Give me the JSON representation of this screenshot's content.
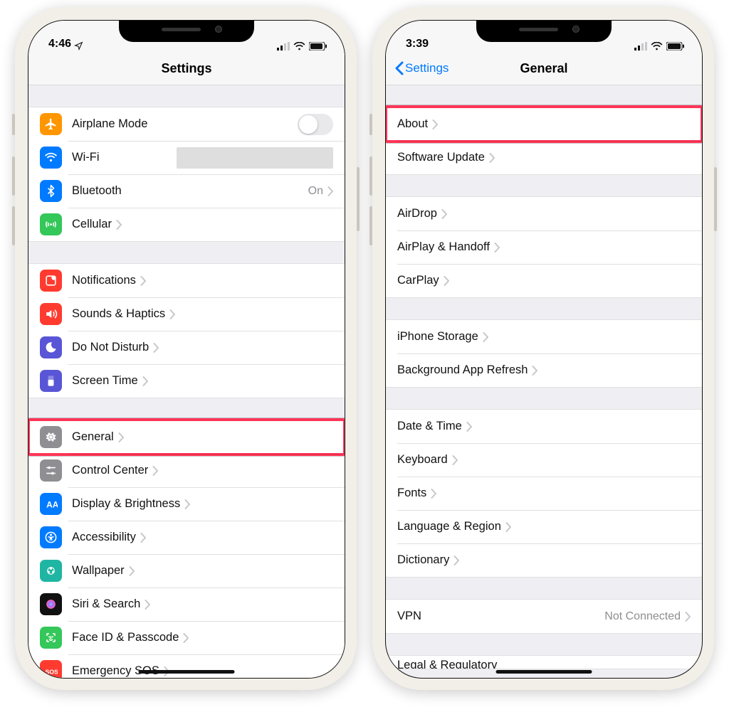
{
  "left": {
    "status": {
      "time": "4:46"
    },
    "nav": {
      "title": "Settings"
    },
    "groups": [
      {
        "rows": [
          {
            "id": "airplane",
            "label": "Airplane Mode",
            "icon": "airplane-icon",
            "type": "toggle"
          },
          {
            "id": "wifi",
            "label": "Wi-Fi",
            "icon": "wifi-icon",
            "type": "wifi"
          },
          {
            "id": "bluetooth",
            "label": "Bluetooth",
            "icon": "bluetooth-icon",
            "type": "nav",
            "value": "On"
          },
          {
            "id": "cellular",
            "label": "Cellular",
            "icon": "cellular-icon",
            "type": "nav"
          }
        ]
      },
      {
        "rows": [
          {
            "id": "notifications",
            "label": "Notifications",
            "icon": "notifications-icon",
            "type": "nav"
          },
          {
            "id": "sounds",
            "label": "Sounds & Haptics",
            "icon": "sounds-icon",
            "type": "nav"
          },
          {
            "id": "dnd",
            "label": "Do Not Disturb",
            "icon": "dnd-icon",
            "type": "nav"
          },
          {
            "id": "screentime",
            "label": "Screen Time",
            "icon": "screentime-icon",
            "type": "nav"
          }
        ]
      },
      {
        "rows": [
          {
            "id": "general",
            "label": "General",
            "icon": "general-icon",
            "type": "nav",
            "highlight": true
          },
          {
            "id": "controlcenter",
            "label": "Control Center",
            "icon": "controlcenter-icon",
            "type": "nav"
          },
          {
            "id": "display",
            "label": "Display & Brightness",
            "icon": "display-icon",
            "type": "nav"
          },
          {
            "id": "accessibility",
            "label": "Accessibility",
            "icon": "accessibility-icon",
            "type": "nav"
          },
          {
            "id": "wallpaper",
            "label": "Wallpaper",
            "icon": "wallpaper-icon",
            "type": "nav"
          },
          {
            "id": "siri",
            "label": "Siri & Search",
            "icon": "siri-icon",
            "type": "nav"
          },
          {
            "id": "faceid",
            "label": "Face ID & Passcode",
            "icon": "faceid-icon",
            "type": "nav"
          },
          {
            "id": "emergency",
            "label": "Emergency SOS",
            "icon": "emergency-icon",
            "type": "nav"
          }
        ]
      }
    ]
  },
  "right": {
    "status": {
      "time": "3:39"
    },
    "nav": {
      "title": "General",
      "back": "Settings"
    },
    "groups": [
      {
        "rows": [
          {
            "id": "about",
            "label": "About",
            "type": "nav",
            "highlight": true
          },
          {
            "id": "swupdate",
            "label": "Software Update",
            "type": "nav"
          }
        ]
      },
      {
        "rows": [
          {
            "id": "airdrop",
            "label": "AirDrop",
            "type": "nav"
          },
          {
            "id": "airplay",
            "label": "AirPlay & Handoff",
            "type": "nav"
          },
          {
            "id": "carplay",
            "label": "CarPlay",
            "type": "nav"
          }
        ]
      },
      {
        "rows": [
          {
            "id": "storage",
            "label": "iPhone Storage",
            "type": "nav"
          },
          {
            "id": "bgapp",
            "label": "Background App Refresh",
            "type": "nav"
          }
        ]
      },
      {
        "rows": [
          {
            "id": "datetime",
            "label": "Date & Time",
            "type": "nav"
          },
          {
            "id": "keyboard",
            "label": "Keyboard",
            "type": "nav"
          },
          {
            "id": "fonts",
            "label": "Fonts",
            "type": "nav"
          },
          {
            "id": "lang",
            "label": "Language & Region",
            "type": "nav"
          },
          {
            "id": "dict",
            "label": "Dictionary",
            "type": "nav"
          }
        ]
      },
      {
        "rows": [
          {
            "id": "vpn",
            "label": "VPN",
            "type": "nav",
            "value": "Not Connected"
          }
        ]
      }
    ],
    "cut_label": "Legal & Regulatory"
  }
}
